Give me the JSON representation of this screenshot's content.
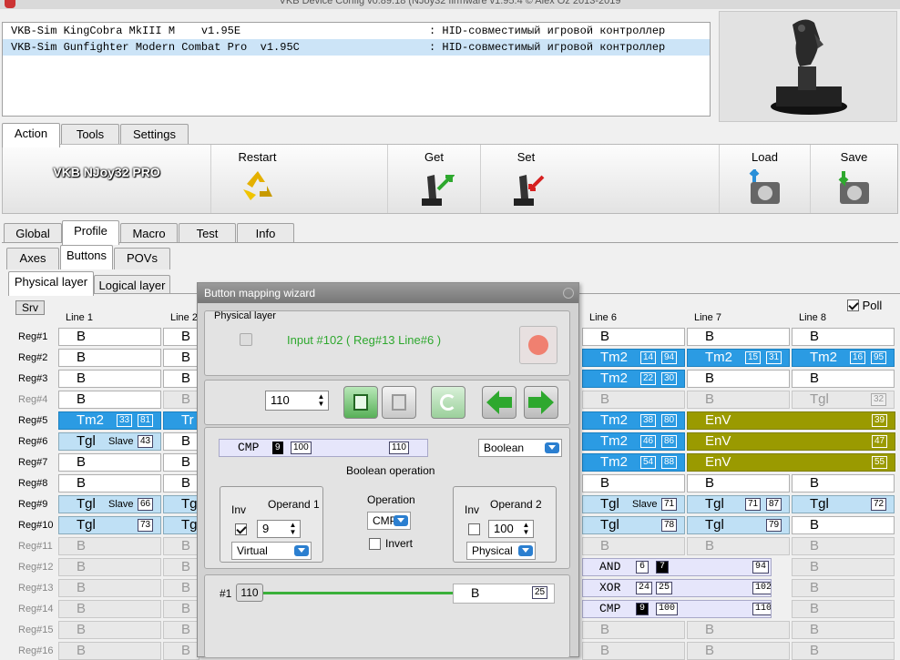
{
  "window": {
    "title": "VKB Device Config v0.89.18 (NJoy32 firmware v1.95.4 © Alex Oz 2013-2019"
  },
  "devices": [
    {
      "name": "VKB-Sim KingCobra MkIII M    v1.95E",
      "desc": ": HID-совместимый игровой контроллер"
    },
    {
      "name": "VKB-Sim Gunfighter Modern Combat Pro  v1.95C",
      "desc": ": HID-совместимый игровой контроллер"
    }
  ],
  "main_tabs": [
    "Action",
    "Tools",
    "Settings"
  ],
  "action": {
    "brand": "VKB NJoy32 PRO",
    "buttons": {
      "restart": "Restart",
      "get": "Get",
      "set": "Set",
      "load": "Load",
      "save": "Save"
    }
  },
  "config_tabs": [
    "Global",
    "Profile",
    "Macro",
    "Test",
    "Info"
  ],
  "profile_tabs": [
    "Axes",
    "Buttons",
    "POVs"
  ],
  "layer_tabs": [
    "Physical layer",
    "Logical layer"
  ],
  "srv_label": "Srv",
  "poll_label": "Poll",
  "columns": [
    "Line 1",
    "Line 2",
    "Line 6",
    "Line 7",
    "Line 8"
  ],
  "regs": [
    "Reg#1",
    "Reg#2",
    "Reg#3",
    "Reg#4",
    "Reg#5",
    "Reg#6",
    "Reg#7",
    "Reg#8",
    "Reg#9",
    "Reg#10",
    "Reg#11",
    "Reg#12",
    "Reg#13",
    "Reg#14",
    "Reg#15",
    "Reg#16"
  ],
  "grid": {
    "line1": [
      {
        "s": "w",
        "t": "B"
      },
      {
        "s": "w",
        "t": "B"
      },
      {
        "s": "w",
        "t": "B"
      },
      {
        "s": "w",
        "t": "B"
      },
      {
        "s": "b",
        "t": "Tm2",
        "n": [
          "33",
          "81"
        ]
      },
      {
        "s": "l",
        "t": "Tgl",
        "sl": "Slave",
        "n": [
          "43"
        ]
      },
      {
        "s": "w",
        "t": "B"
      },
      {
        "s": "w",
        "t": "B"
      },
      {
        "s": "l",
        "t": "Tgl",
        "sl": "Slave",
        "n": [
          "66"
        ]
      },
      {
        "s": "l",
        "t": "Tgl",
        "n": [
          "73"
        ]
      },
      {
        "s": "g",
        "t": "B"
      },
      {
        "s": "g",
        "t": "B"
      },
      {
        "s": "g",
        "t": "B"
      },
      {
        "s": "g",
        "t": "B"
      },
      {
        "s": "g",
        "t": "B"
      },
      {
        "s": "g",
        "t": "B"
      }
    ],
    "line2": [
      {
        "s": "w",
        "t": "B"
      },
      {
        "s": "w",
        "t": "B"
      },
      {
        "s": "w",
        "t": "B"
      },
      {
        "s": "g",
        "t": "B"
      },
      {
        "s": "b",
        "t": "Tr"
      },
      {
        "s": "w",
        "t": "B"
      },
      {
        "s": "w",
        "t": "B"
      },
      {
        "s": "w",
        "t": "B"
      },
      {
        "s": "l",
        "t": "Tg"
      },
      {
        "s": "l",
        "t": "Tg"
      },
      {
        "s": "g",
        "t": "B"
      },
      {
        "s": "g",
        "t": "B"
      },
      {
        "s": "g",
        "t": "B"
      },
      {
        "s": "g",
        "t": "B"
      },
      {
        "s": "g",
        "t": "B"
      },
      {
        "s": "g",
        "t": "B"
      }
    ],
    "line6": [
      {
        "s": "w",
        "t": "B"
      },
      {
        "s": "b",
        "t": "Tm2",
        "n": [
          "14",
          "94"
        ]
      },
      {
        "s": "b",
        "t": "Tm2",
        "n": [
          "22",
          "30"
        ]
      },
      {
        "s": "g",
        "t": "B"
      },
      {
        "s": "b",
        "t": "Tm2",
        "n": [
          "38",
          "80"
        ]
      },
      {
        "s": "b",
        "t": "Tm2",
        "n": [
          "46",
          "86"
        ]
      },
      {
        "s": "b",
        "t": "Tm2",
        "n": [
          "54",
          "88"
        ]
      },
      {
        "s": "w",
        "t": "B"
      },
      {
        "s": "l",
        "t": "Tgl",
        "sl": "Slave",
        "n": [
          "71"
        ]
      },
      {
        "s": "l",
        "t": "Tgl",
        "n": [
          "78"
        ]
      },
      {
        "s": "g",
        "t": "B"
      },
      {
        "s": "v",
        "t": "AND",
        "n": [
          "6",
          "7k",
          "94"
        ]
      },
      {
        "s": "v",
        "t": "XOR",
        "n": [
          "24",
          "25",
          "102"
        ]
      },
      {
        "s": "v",
        "t": "CMP",
        "n": [
          "9k",
          "100",
          "110"
        ]
      },
      {
        "s": "g",
        "t": "B"
      },
      {
        "s": "g",
        "t": "B"
      }
    ],
    "line7": [
      {
        "s": "w",
        "t": "B"
      },
      {
        "s": "b",
        "t": "Tm2",
        "n": [
          "15",
          "31"
        ]
      },
      {
        "s": "w",
        "t": "B"
      },
      {
        "s": "g",
        "t": "B"
      },
      {
        "s": "o",
        "t": "EnV",
        "n": [
          "39"
        ]
      },
      {
        "s": "o",
        "t": "EnV",
        "n": [
          "47"
        ]
      },
      {
        "s": "o",
        "t": "EnV",
        "n": [
          "55"
        ]
      },
      {
        "s": "w",
        "t": "B"
      },
      {
        "s": "l",
        "t": "Tgl",
        "n": [
          "71",
          "87"
        ]
      },
      {
        "s": "l",
        "t": "Tgl",
        "n": [
          "79"
        ]
      },
      {
        "s": "g",
        "t": "B"
      },
      {
        "s": "-"
      },
      {
        "s": "-"
      },
      {
        "s": "-"
      },
      {
        "s": "g",
        "t": "B"
      },
      {
        "s": "g",
        "t": "B"
      }
    ],
    "line8": [
      {
        "s": "w",
        "t": "B"
      },
      {
        "s": "b",
        "t": "Tm2",
        "n": [
          "16",
          "95"
        ]
      },
      {
        "s": "w",
        "t": "B"
      },
      {
        "s": "g",
        "t": "Tgl",
        "n": [
          "32"
        ]
      },
      {
        "s": "o",
        "t": ""
      },
      {
        "s": "o",
        "t": ""
      },
      {
        "s": "o",
        "t": ""
      },
      {
        "s": "w",
        "t": "B"
      },
      {
        "s": "l",
        "t": "Tgl",
        "n": [
          "72"
        ]
      },
      {
        "s": "w",
        "t": "B"
      },
      {
        "s": "g",
        "t": "B"
      },
      {
        "s": "g",
        "t": "B"
      },
      {
        "s": "g",
        "t": "B"
      },
      {
        "s": "g",
        "t": "B"
      },
      {
        "s": "g",
        "t": "B"
      },
      {
        "s": "g",
        "t": "B"
      }
    ]
  },
  "wizard": {
    "title": "Button mapping wizard",
    "physical_layer": "Physical layer",
    "input_info": "Input #102 ( Reg#13  Line#6 )",
    "button_number": "110",
    "cmp_label": "CMP",
    "cmp_op1": "9",
    "cmp_op2": "100",
    "cmp_result": "110",
    "mode": "Boolean",
    "boolean_operation": "Boolean operation",
    "operand1": {
      "title": "Operand 1",
      "inv": "Inv",
      "value": "9",
      "source": "Virtual"
    },
    "operation": {
      "title": "Operation",
      "value": "CMP",
      "invert": "Invert"
    },
    "operand2": {
      "title": "Operand 2",
      "inv": "Inv",
      "value": "100",
      "source": "Physical"
    },
    "bottom": {
      "index": "#1",
      "number": "110",
      "button": "B",
      "value": "25"
    }
  },
  "colors": {
    "blue": "#2b9be3",
    "olive": "#9a9a00",
    "green_text": "#2ea82e"
  }
}
